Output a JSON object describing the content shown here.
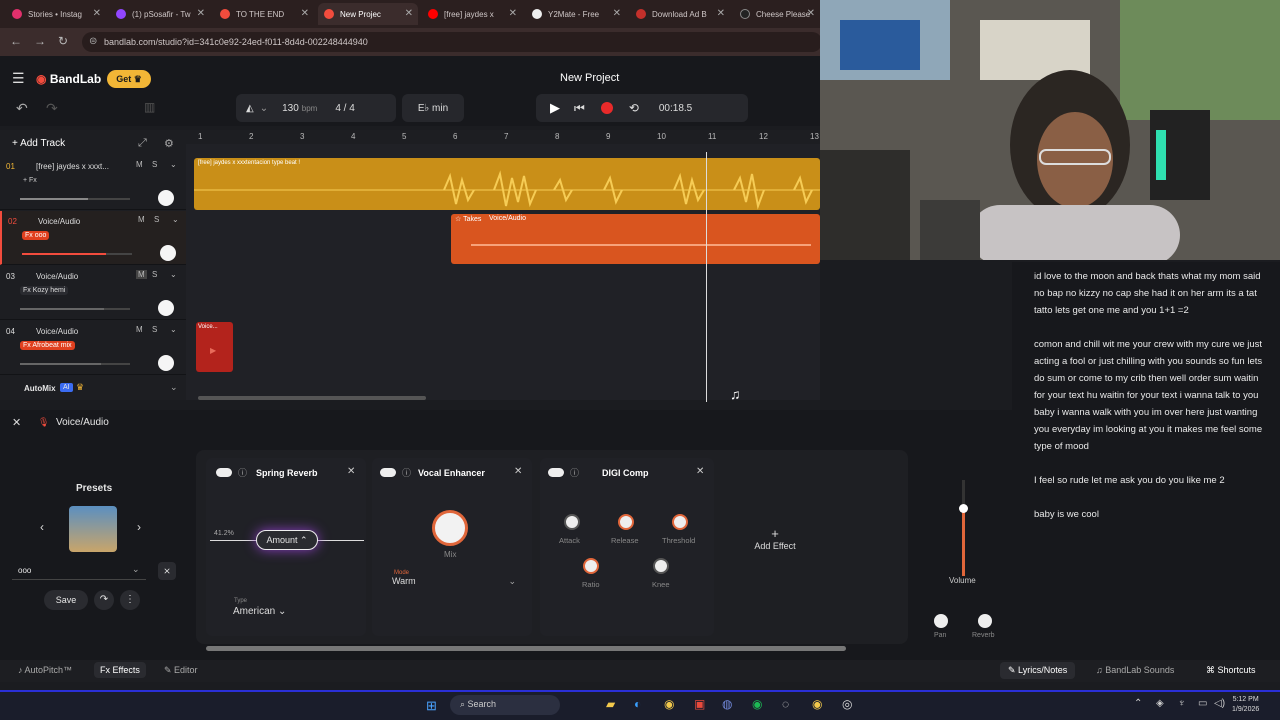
{
  "browser": {
    "tabs": [
      {
        "title": "Stories • Instag",
        "color": "#e1306c"
      },
      {
        "title": "(1) pSosafir - Tw",
        "color": "#9146ff"
      },
      {
        "title": "TO THE END",
        "color": "#f24c3d"
      },
      {
        "title": "New Projec",
        "color": "#f24c3d"
      },
      {
        "title": "[free] jaydes x",
        "color": "#ff0000"
      },
      {
        "title": "Y2Mate - Free",
        "color": "#eeeeee"
      },
      {
        "title": "Download Ad B",
        "color": "#c4302b"
      },
      {
        "title": "Cheese Please",
        "color": "#222222"
      }
    ],
    "url": "bandlab.com/studio?id=341c0e92-24ed-f011-8d4d-002248444940"
  },
  "header": {
    "logo": "BandLab",
    "get_label": "Get",
    "project_title": "New Project"
  },
  "transport": {
    "bpm": "130",
    "bpm_unit": "bpm",
    "time_sig": "4 / 4",
    "key": "E♭ min",
    "time": "00:18.5"
  },
  "tracks": {
    "add_label": "Add Track",
    "items": [
      {
        "num": "01",
        "name": "[free] jaydes x xxxt...",
        "fx": "+ Fx",
        "fx_color": "",
        "vol": 0.62
      },
      {
        "num": "02",
        "name": "Voice/Audio",
        "fx": "Fx ooo",
        "fx_color": "#e0401f",
        "vol": 0.76
      },
      {
        "num": "03",
        "name": "Voice/Audio",
        "fx": "Fx Kozy hemi",
        "fx_color": "#2a2b30",
        "vol": 0.76
      },
      {
        "num": "04",
        "name": "Voice/Audio",
        "fx": "Fx Afrobeat mix",
        "fx_color": "#e0401f",
        "vol": 0.74
      }
    ],
    "automix": "AutoMix",
    "ai": "AI"
  },
  "arrange": {
    "ruler": [
      "1",
      "2",
      "3",
      "4",
      "5",
      "6",
      "7",
      "8",
      "9",
      "10",
      "11",
      "12",
      "13"
    ],
    "clip1": "[free] jaydes x xxxtentacion type beat !",
    "clip2_a": "Takes",
    "clip2_b": "Voice/Audio",
    "clip3": "Voice..."
  },
  "lyrics": {
    "paragraphs": [
      "id love to the moon and back thats what my mom said no bap no kizzy no cap she had it on her arm its a tat tatto lets get one me and you 1+1 =2",
      "comon and chill wit me your crew with my cure we just acting a fool or just chilling with you sounds so fun lets do sum or come to my crib then well order sum waitin for your text hu waitin for your text i wanna talk to you baby i wanna walk with you im over here just wanting you everyday im looking at you it makes me feel some type of mood",
      "I feel so rude let me ask you do you like me 2",
      "baby is we cool"
    ]
  },
  "editor": {
    "track_name": "Voice/Audio",
    "presets_label": "Presets",
    "preset_value": "ooo",
    "save_label": "Save",
    "effects": [
      {
        "name": "Spring Reverb",
        "pct": "41.2%",
        "knob": "Amount",
        "type_label": "Type",
        "type_value": "American"
      },
      {
        "name": "Vocal Enhancer",
        "knob": "Mix",
        "mode_label": "Mode",
        "mode_value": "Warm"
      },
      {
        "name": "DIGI Comp",
        "knobs": [
          "Attack",
          "Release",
          "Threshold",
          "Ratio",
          "Knee"
        ]
      }
    ],
    "add_effect": "Add Effect",
    "volume_label": "Volume",
    "pan_label": "Pan",
    "reverb_label": "Reverb"
  },
  "bottombar": {
    "autopitch": "AutoPitch™",
    "effects": "Effects",
    "editor": "Editor",
    "lyrics": "Lyrics/Notes",
    "sounds": "BandLab Sounds",
    "shortcuts": "Shortcuts"
  },
  "taskbar": {
    "search": "Search",
    "time": "5:12 PM",
    "date": "1/9/2026"
  }
}
